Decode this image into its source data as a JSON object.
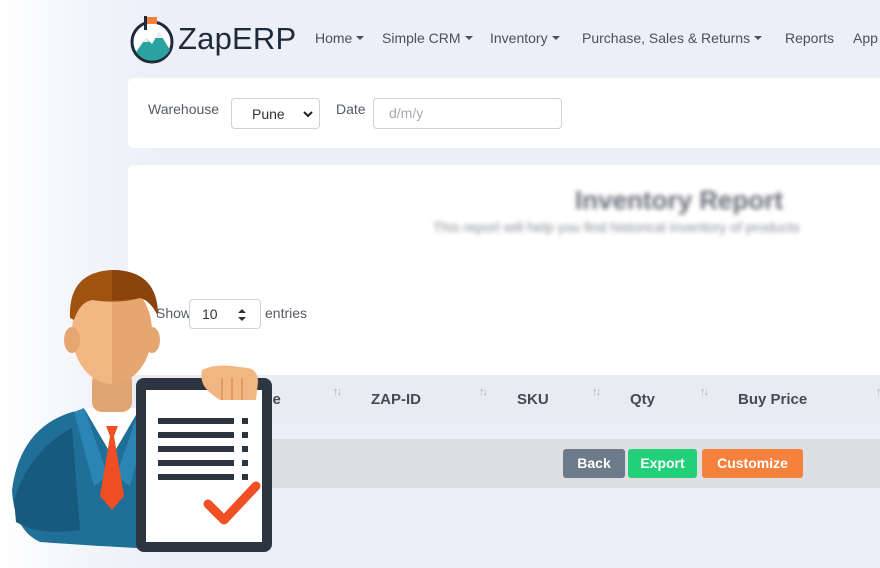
{
  "brand": {
    "name": "ZapERP"
  },
  "nav": {
    "items": [
      {
        "label": "Home",
        "dropdown": true
      },
      {
        "label": "Simple CRM",
        "dropdown": true
      },
      {
        "label": "Inventory",
        "dropdown": true
      },
      {
        "label": "Purchase, Sales & Returns",
        "dropdown": true
      },
      {
        "label": "Reports",
        "dropdown": false
      },
      {
        "label": "App",
        "dropdown": false
      }
    ]
  },
  "filters": {
    "warehouse_label": "Warehouse",
    "warehouse_value": "Pune",
    "date_label": "Date",
    "date_placeholder": "d/m/y"
  },
  "report": {
    "title": "Inventory Report",
    "subtitle": "This report will help you find historical inventory of products"
  },
  "table_length": {
    "show_label": "Show",
    "value": "10",
    "entries_label": "entries"
  },
  "table": {
    "columns": [
      "Name",
      "ZAP-ID",
      "SKU",
      "Qty",
      "Buy Price"
    ]
  },
  "actions": {
    "back": "Back",
    "export": "Export",
    "customize": "Customize"
  },
  "colors": {
    "back": "#6c7a8a",
    "export": "#22d07a",
    "customize": "#f6813d",
    "page_bg": "#eceff8"
  }
}
